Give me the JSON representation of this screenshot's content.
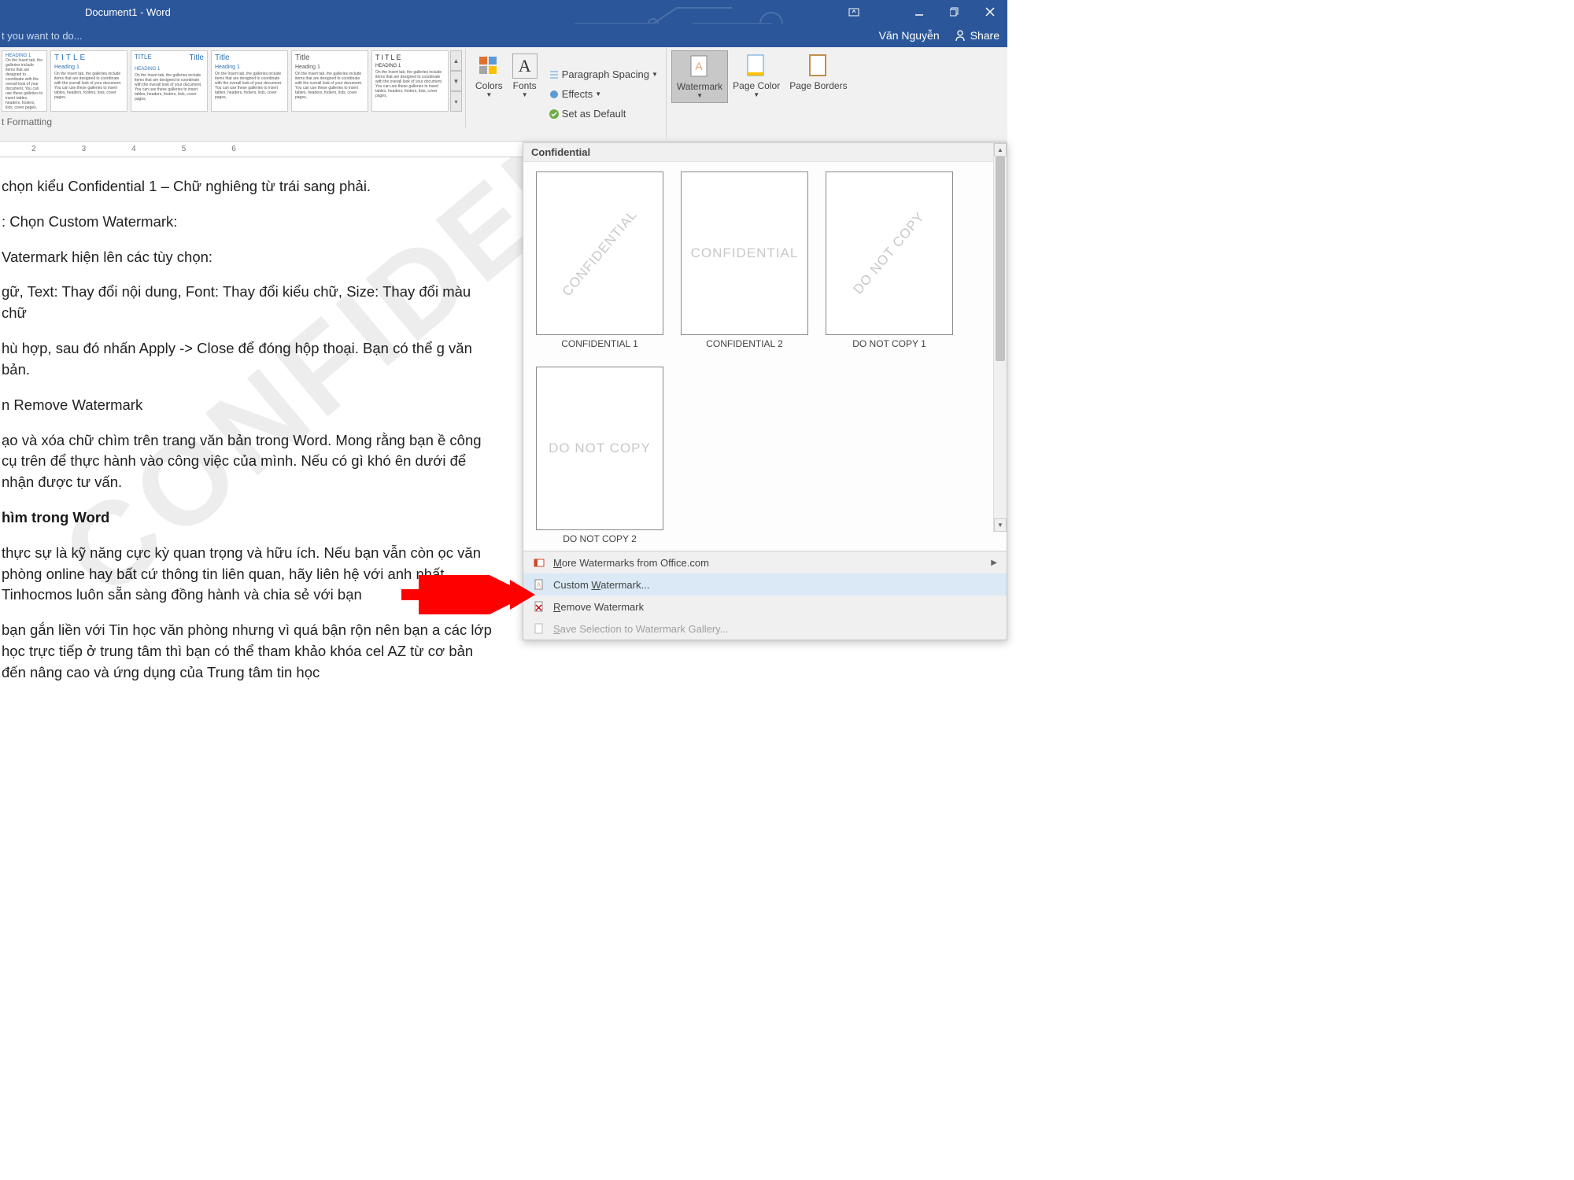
{
  "title": "Document1 - Word",
  "search_placeholder": "t you want to do...",
  "user": "Văn Nguyễn",
  "share": "Share",
  "ribbon": {
    "colors": "Colors",
    "fonts": "Fonts",
    "paragraph_spacing": "Paragraph Spacing",
    "effects": "Effects",
    "set_default": "Set as Default",
    "watermark": "Watermark",
    "page_color": "Page Color",
    "page_borders": "Page Borders",
    "doc_formatting": "t Formatting",
    "style_title_caps": "TITLE",
    "style_title": "Title",
    "style_heading1": "Heading 1",
    "style_heading1_caps": "HEADING 1",
    "style_lorem": "On the Insert tab, the galleries include items that are designed to coordinate with the overall look of your document. You can use these galleries to insert tables, headers, footers, lists, cover pages,"
  },
  "ruler": [
    "2",
    "3",
    "4",
    "5",
    "6"
  ],
  "doc": {
    "p1": "chọn kiểu Confidential 1 – Chữ nghiêng từ trái sang phải.",
    "p2": ": Chọn Custom Watermark:",
    "p3": "Vatermark hiện lên các tùy chọn:",
    "p4": "gữ, Text: Thay đổi nội dung, Font: Thay đổi kiểu chữ, Size: Thay đổi màu chữ",
    "p5": "hù hợp, sau đó nhấn Apply -> Close để đóng hộp thoại. Bạn có thể g văn bản.",
    "p6": "n Remove Watermark",
    "p7": "ạo và xóa chữ chìm trên trang văn bản trong Word. Mong rằng bạn ề công cụ trên để thực hành vào công việc của mình. Nếu có gì khó ên dưới để nhận được tư vấn.",
    "p8": "hìm trong Word",
    "p9": "thực sự là kỹ năng cực kỳ quan trọng và hữu ích. Nếu bạn vẫn còn ọc văn phòng online hay bất cứ thông tin liên quan, hãy liên hệ với anh nhất. Tinhocmos luôn sẵn sàng đồng hành và chia sẻ với bạn",
    "p10": "bạn gắn liền với Tin học văn phòng nhưng vì quá bận rộn nên bạn a các lớp học trực tiếp ở trung tâm thì bạn có thể tham khảo khóa cel AZ từ cơ bản đến nâng cao và ứng dụng của Trung tâm tin học",
    "wm": "CONFIDENTIAL"
  },
  "dropdown": {
    "section": "Confidential",
    "items": [
      {
        "caption": "CONFIDENTIAL 1",
        "text": "CONFIDENTIAL",
        "diagonal": true
      },
      {
        "caption": "CONFIDENTIAL 2",
        "text": "CONFIDENTIAL",
        "diagonal": false
      },
      {
        "caption": "DO NOT COPY 1",
        "text": "DO NOT COPY",
        "diagonal": true
      },
      {
        "caption": "DO NOT COPY 2",
        "text": "DO NOT COPY",
        "diagonal": false
      }
    ],
    "more": "More Watermarks from Office.com",
    "custom": "Custom Watermark...",
    "remove": "Remove Watermark",
    "save_sel": "Save Selection to Watermark Gallery...",
    "accel": {
      "more": "M",
      "custom": "W",
      "remove": "R",
      "save": "S"
    }
  }
}
